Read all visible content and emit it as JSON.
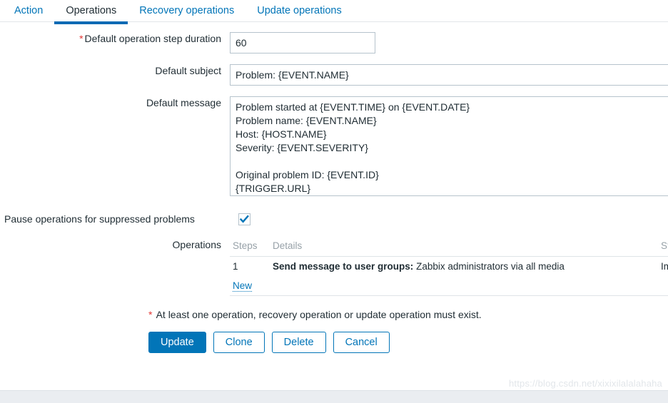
{
  "tabs": [
    {
      "label": "Action",
      "active": false
    },
    {
      "label": "Operations",
      "active": true
    },
    {
      "label": "Recovery operations",
      "active": false
    },
    {
      "label": "Update operations",
      "active": false
    }
  ],
  "form": {
    "duration": {
      "label": "Default operation step duration",
      "required_marker": "*",
      "value": "60"
    },
    "subject": {
      "label": "Default subject",
      "value": "Problem: {EVENT.NAME}"
    },
    "message": {
      "label": "Default message",
      "value": "Problem started at {EVENT.TIME} on {EVENT.DATE}\nProblem name: {EVENT.NAME}\nHost: {HOST.NAME}\nSeverity: {EVENT.SEVERITY}\n\nOriginal problem ID: {EVENT.ID}\n{TRIGGER.URL}"
    },
    "pause": {
      "label": "Pause operations for suppressed problems",
      "checked": true
    },
    "operations": {
      "label": "Operations",
      "columns": [
        "Steps",
        "Details",
        "Start"
      ],
      "rows": [
        {
          "steps": "1",
          "details_bold": "Send message to user groups:",
          "details_rest": "Zabbix administrators via all media",
          "start": "Immediately"
        }
      ],
      "new_link": "New"
    }
  },
  "footer": {
    "note_marker": "*",
    "note": "At least one operation, recovery operation or update operation must exist.",
    "buttons": [
      {
        "label": "Update",
        "style": "primary"
      },
      {
        "label": "Clone",
        "style": "ghost"
      },
      {
        "label": "Delete",
        "style": "ghost"
      },
      {
        "label": "Cancel",
        "style": "ghost"
      }
    ]
  },
  "watermark": "https://blog.csdn.net/xixixilalalahaha",
  "colors": {
    "accent": "#0275b8",
    "active_tab_underline": "#0d6ab4",
    "required": "#e33734",
    "border": "#b6c3cc",
    "muted": "#97a1a8"
  }
}
